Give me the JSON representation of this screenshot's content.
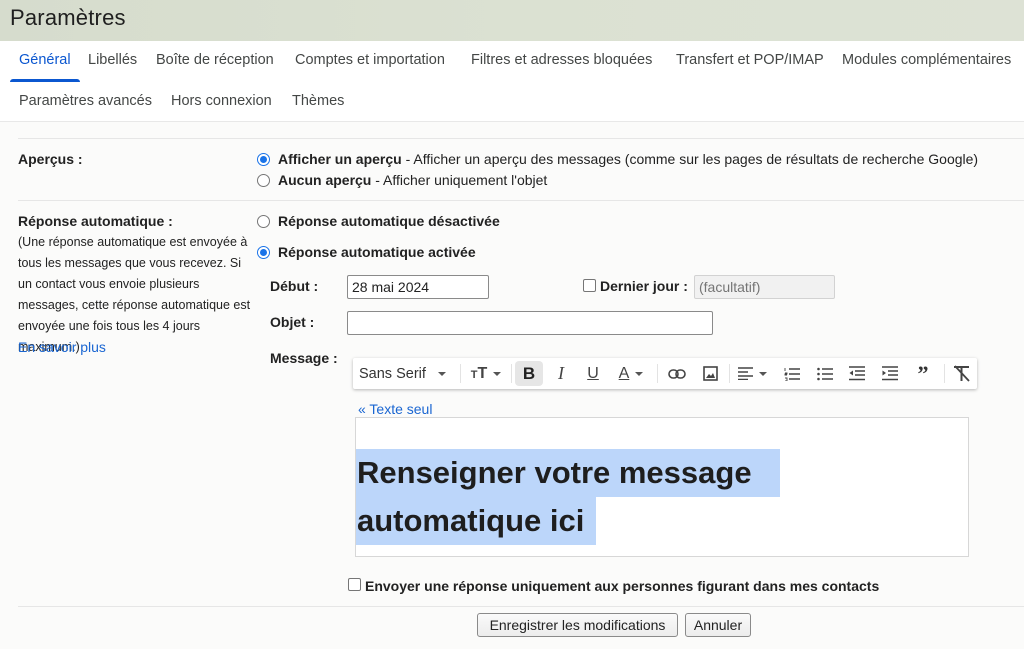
{
  "window": {
    "title": "Paramètres"
  },
  "tabs": [
    {
      "label": "Général",
      "active": true
    },
    {
      "label": "Libellés"
    },
    {
      "label": "Boîte de réception"
    },
    {
      "label": "Comptes et importation"
    },
    {
      "label": "Filtres et adresses bloquées"
    },
    {
      "label": "Transfert et POP/IMAP"
    },
    {
      "label": "Modules complémentaires"
    },
    {
      "label": "Paramètres avancés"
    },
    {
      "label": "Hors connexion"
    },
    {
      "label": "Thèmes"
    }
  ],
  "previews": {
    "label": "Aperçus :",
    "options": [
      {
        "title": "Afficher un aperçu",
        "desc": " - Afficher un aperçu des messages (comme sur les pages de résultats de recherche Google)",
        "checked": true
      },
      {
        "title": "Aucun aperçu",
        "desc": " - Afficher uniquement l'objet",
        "checked": false
      }
    ]
  },
  "auto_reply": {
    "label": "Réponse automatique :",
    "description": "(Une réponse automatique est envoyée à tous les messages que vous recevez. Si un contact vous envoie plusieurs messages, cette réponse automatique est envoyée une fois tous les 4 jours maximum.)",
    "learn_more": "En savoir plus",
    "options": [
      {
        "label": "Réponse automatique désactivée",
        "checked": false
      },
      {
        "label": "Réponse automatique activée",
        "checked": true
      }
    ],
    "start_label": "Début :",
    "start_value": "28 mai 2024",
    "last_day_label": "Dernier jour :",
    "last_day_checked": false,
    "last_day_placeholder": "(facultatif)",
    "subject_label": "Objet :",
    "subject_value": "",
    "message_label": "Message :",
    "plain_text_link": "« Texte seul",
    "message_lines": [
      "Renseigner votre message",
      "automatique ici"
    ],
    "contacts_only_label": "Envoyer une réponse uniquement aux personnes figurant dans mes contacts",
    "contacts_only_checked": false
  },
  "toolbar": {
    "font": "Sans Serif",
    "buttons": [
      "font-size",
      "bold",
      "italic",
      "underline",
      "text-color",
      "link",
      "image",
      "align",
      "numbered-list",
      "bulleted-list",
      "indent-less",
      "indent-more",
      "quote",
      "remove-formatting"
    ],
    "bold_active": true
  },
  "actions": {
    "save": "Enregistrer les modifications",
    "cancel": "Annuler"
  }
}
